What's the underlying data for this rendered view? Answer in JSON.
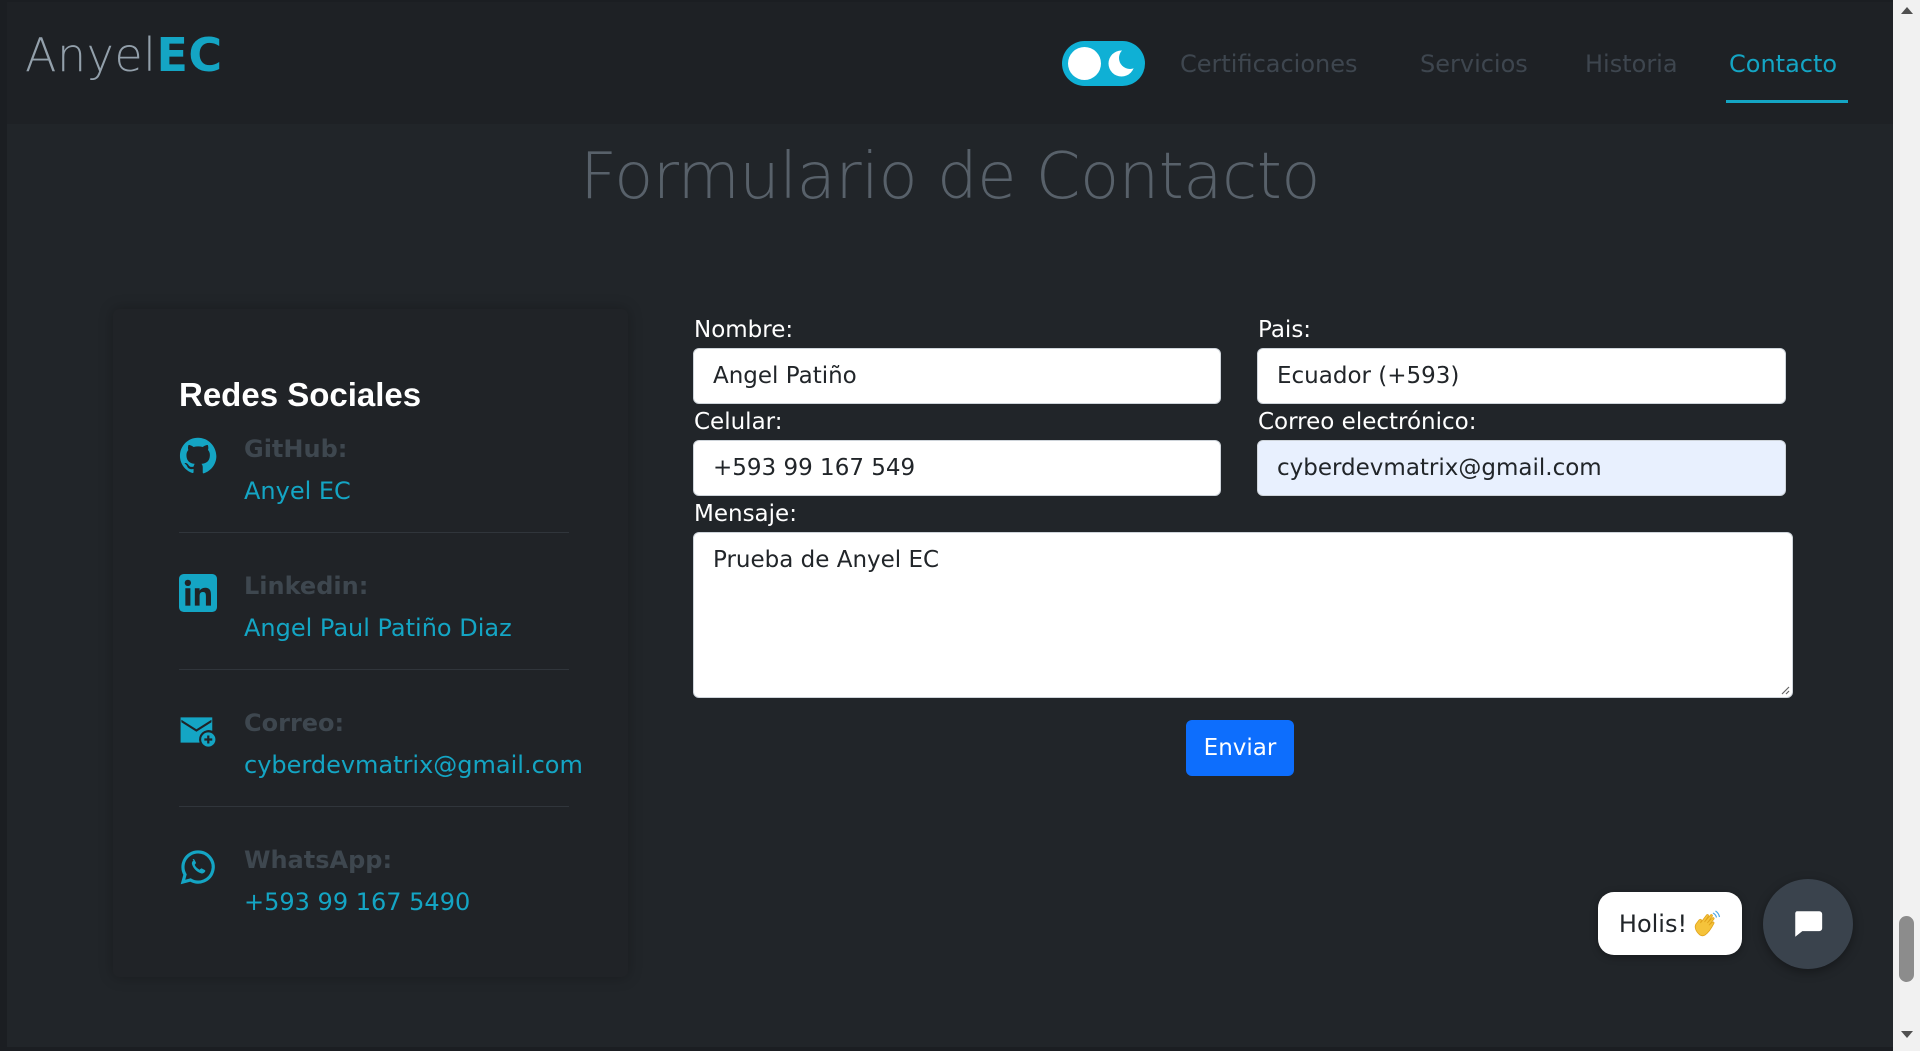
{
  "brand": {
    "name_part": "Anyel",
    "name_accent": "EC"
  },
  "nav": {
    "items": [
      {
        "label": "Certificaciones"
      },
      {
        "label": "Servicios"
      },
      {
        "label": "Historia"
      },
      {
        "label": "Contacto",
        "active": true
      }
    ],
    "theme_toggle_icon": "moon-icon"
  },
  "page": {
    "title": "Formulario de Contacto"
  },
  "social": {
    "heading": "Redes Sociales",
    "items": [
      {
        "label": "GitHub:",
        "value": "Anyel EC",
        "icon": "github-icon"
      },
      {
        "label": "Linkedin:",
        "value": "Angel Paul Patiño Diaz",
        "icon": "linkedin-icon"
      },
      {
        "label": "Correo:",
        "value": "cyberdevmatrix@gmail.com",
        "icon": "mail-icon"
      },
      {
        "label": "WhatsApp:",
        "value": "+593 99 167 5490",
        "icon": "whatsapp-icon"
      }
    ]
  },
  "form": {
    "nombre": {
      "label": "Nombre:",
      "value": "Angel Patiño"
    },
    "pais": {
      "label": "Pais:",
      "value": "Ecuador (+593)"
    },
    "celular": {
      "label": "Celular:",
      "value": "+593 99 167 549"
    },
    "correo": {
      "label": "Correo electrónico:",
      "value": "cyberdevmatrix@gmail.com"
    },
    "mensaje": {
      "label": "Mensaje:",
      "value": "Prueba de Anyel EC"
    },
    "submit_label": "Enviar"
  },
  "chat": {
    "bubble_text": "Holis!",
    "bubble_emoji": "waving-hand-icon",
    "button_icon": "chat-icon"
  },
  "colors": {
    "accent": "#14a5c4",
    "primary_button": "#0d6efd",
    "background": "#212529"
  }
}
